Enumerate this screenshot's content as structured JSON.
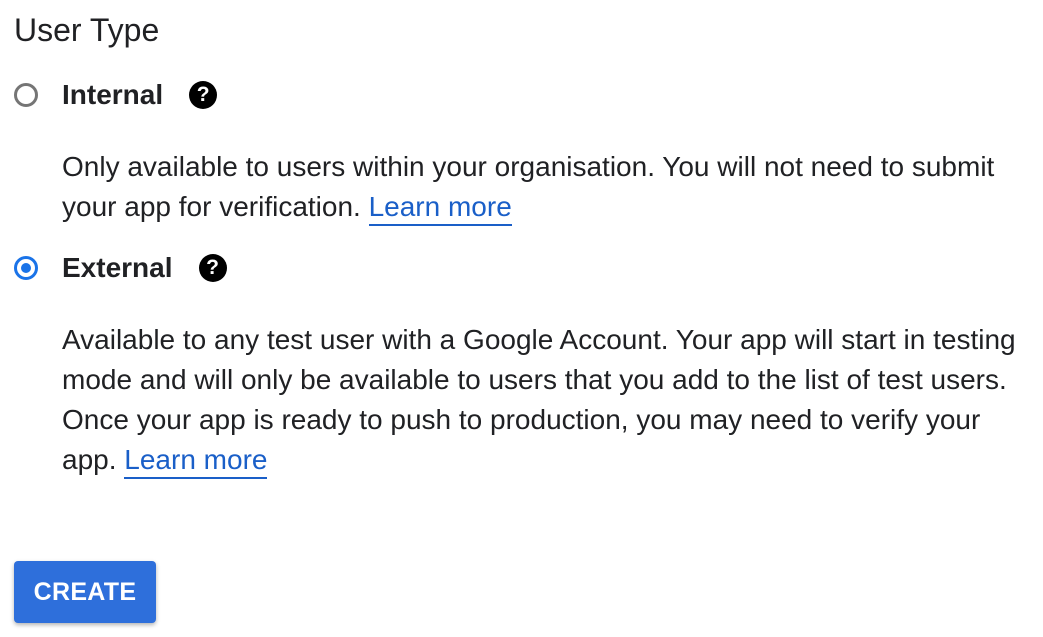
{
  "section_title": "User Type",
  "options": [
    {
      "label": "Internal",
      "selected": false,
      "help_icon": "question-circle-icon",
      "help_glyph": "?",
      "description": "Only available to users within your organisation. You will not need to submit your app for verification.",
      "link_text": "Learn more"
    },
    {
      "label": "External",
      "selected": true,
      "help_icon": "question-circle-icon",
      "help_glyph": "?",
      "description": "Available to any test user with a Google Account. Your app will start in testing mode and will only be available to users that you add to the list of test users. Once your app is ready to push to production, you may need to verify your app.",
      "link_text": "Learn more"
    }
  ],
  "create_button_label": "CREATE",
  "colors": {
    "accent": "#1a73e8",
    "link": "#1a5fc8",
    "button_bg": "#2e6fdb",
    "radio_unchecked": "#757575",
    "text": "#202124"
  }
}
